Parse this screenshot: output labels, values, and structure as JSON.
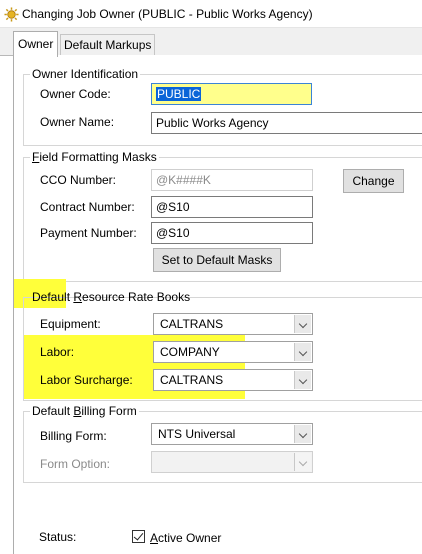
{
  "window": {
    "title": "Changing Job Owner  (PUBLIC - Public Works Agency)",
    "icon": "gear-sun-icon"
  },
  "tabs": [
    {
      "label": "Owner"
    },
    {
      "label": "Default Markups"
    }
  ],
  "owner_identification": {
    "legend": "Owner Identification",
    "owner_code_label": "Owner Code:",
    "owner_code_value": "PUBLIC",
    "owner_name_label": "Owner Name:",
    "owner_name_value": "Public Works Agency"
  },
  "field_masks": {
    "legend_first": "F",
    "legend_rest": "ield Formatting Masks",
    "cco_label": "CCO Number:",
    "cco_value": "@K####K",
    "change_button": "Change",
    "contract_label": "Contract Number:",
    "contract_value": "@S10",
    "payment_label": "Payment Number:",
    "payment_value": "@S10",
    "default_masks_button": "Set to Default Masks"
  },
  "rate_books": {
    "legend_before": "Default ",
    "legend_u": "R",
    "legend_after": "esource Rate Books",
    "equipment_label": "Equipment:",
    "equipment_value": "CALTRANS",
    "labor_label": "Labor:",
    "labor_value": "COMPANY",
    "surcharge_label": "Labor Surcharge:",
    "surcharge_value": "CALTRANS"
  },
  "billing": {
    "legend_before": "Default ",
    "legend_u": "B",
    "legend_after": "illing Form",
    "billing_form_label": "Billing Form:",
    "billing_form_value": "NTS Universal",
    "form_option_label": "Form Option:",
    "form_option_value": ""
  },
  "status": {
    "label": "Status:",
    "checkbox_u": "A",
    "checkbox_rest": "ctive Owner",
    "checked": true
  },
  "colors": {
    "highlight": "#ffff3a",
    "selection": "#0a64d8"
  }
}
